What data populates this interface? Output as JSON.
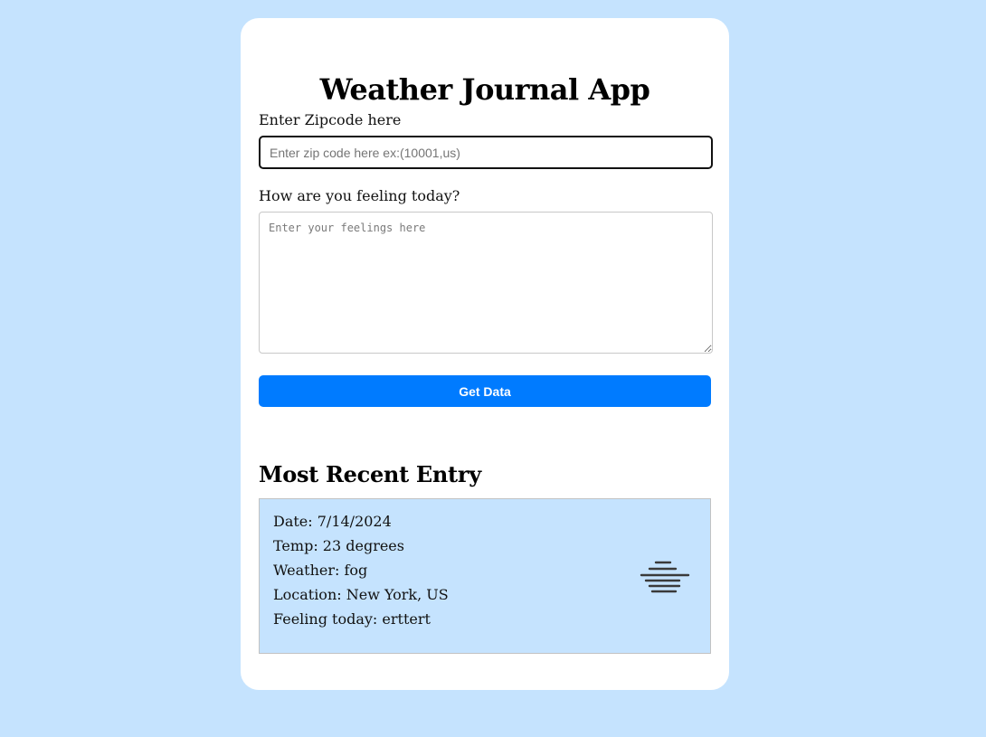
{
  "app": {
    "title": "Weather Journal App"
  },
  "form": {
    "zip_label": "Enter Zipcode here",
    "zip_placeholder": "Enter zip code here ex:(10001,us)",
    "zip_value": "",
    "feelings_label": "How are you feeling today?",
    "feelings_placeholder": "Enter your feelings here",
    "feelings_value": "",
    "submit_label": "Get Data"
  },
  "recent": {
    "heading": "Most Recent Entry",
    "date": "Date: 7/14/2024",
    "temp": "Temp: 23 degrees",
    "weather": "Weather: fog",
    "location": "Location: New York, US",
    "feeling": "Feeling today: erttert",
    "weather_icon": "fog-icon"
  },
  "colors": {
    "page_background": "#c5e3fe",
    "card_background": "#ffffff",
    "button": "#007bff",
    "entry_background": "#c5e3fe"
  }
}
